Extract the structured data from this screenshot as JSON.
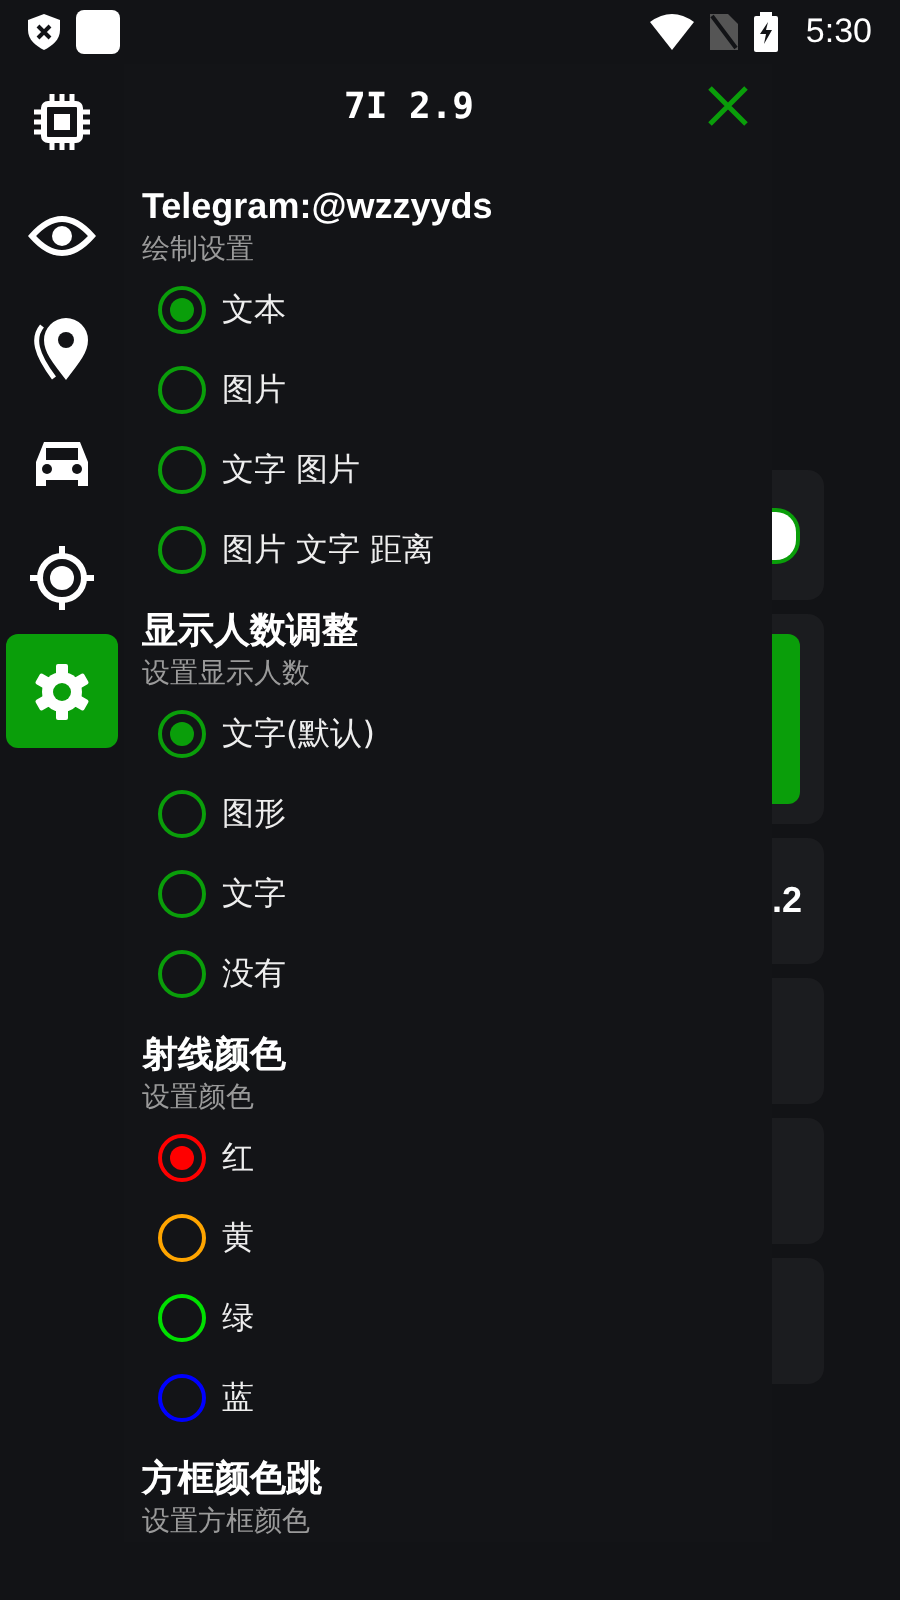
{
  "status_bar": {
    "time": "5:30"
  },
  "sidebar": {
    "items": [
      {
        "selected": false
      },
      {
        "selected": false
      },
      {
        "selected": false
      },
      {
        "selected": false
      },
      {
        "selected": false
      },
      {
        "selected": true
      }
    ]
  },
  "panel": {
    "title": "7I 2.9",
    "sections": [
      {
        "title": "Telegram:@wzzyyds",
        "subtitle": "绘制设置",
        "options": [
          {
            "label": "文本",
            "selected": true
          },
          {
            "label": "图片",
            "selected": false
          },
          {
            "label": "文字 图片",
            "selected": false
          },
          {
            "label": "图片 文字 距离",
            "selected": false
          }
        ]
      },
      {
        "title": "显示人数调整",
        "subtitle": "设置显示人数",
        "options": [
          {
            "label": "文字(默认)",
            "selected": true
          },
          {
            "label": "图形",
            "selected": false
          },
          {
            "label": "文字",
            "selected": false
          },
          {
            "label": "没有",
            "selected": false
          }
        ]
      },
      {
        "title": "射线颜色",
        "subtitle": "设置颜色",
        "options": [
          {
            "label": "红",
            "selected": true,
            "color": "#ff0000"
          },
          {
            "label": "黄",
            "selected": false,
            "color": "#ffa500"
          },
          {
            "label": "绿",
            "selected": false,
            "color": "#00e000"
          },
          {
            "label": "蓝",
            "selected": false,
            "color": "#0000ff"
          }
        ]
      },
      {
        "title": "方框颜色跳",
        "subtitle": "设置方框颜色"
      }
    ]
  },
  "background_cards": [
    {
      "kind": "toggle"
    },
    {
      "kind": "bar"
    },
    {
      "kind": "text",
      "text": ".2"
    },
    {
      "kind": "blank"
    },
    {
      "kind": "blank"
    },
    {
      "kind": "blank"
    }
  ]
}
